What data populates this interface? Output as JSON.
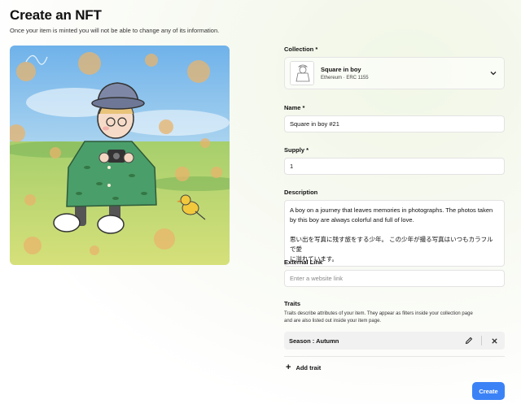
{
  "header": {
    "title": "Create an NFT",
    "subtitle": "Once your item is minted you will not be able to change any of its information."
  },
  "form": {
    "collection": {
      "label": "Collection *",
      "name": "Square in boy",
      "meta": "Ethereum  ·  ERC 1155"
    },
    "name": {
      "label": "Name *",
      "value": "Square in boy #21"
    },
    "supply": {
      "label": "Supply *",
      "value": "1"
    },
    "description": {
      "label": "Description",
      "line1": "A boy on a journey that leaves memories in photographs. The photos taken",
      "line2": "by this boy are always colorful and full of love.",
      "line3": "思い出を写真に残す旅をする少年。 この少年が撮る写真はいつもカラフルで愛",
      "line4": "に溢れています。"
    },
    "external_link": {
      "label": "External Link",
      "placeholder": "Enter a website link"
    },
    "traits": {
      "label": "Traits",
      "help1": "Traits describe attributes of your item. They appear as filters inside your collection page",
      "help2": "and are also listed out inside your item page.",
      "items": [
        {
          "text": "Season : Autumn"
        }
      ],
      "add_label": "Add trait"
    }
  },
  "actions": {
    "create_label": "Create"
  },
  "colors": {
    "accent": "#3b82f6",
    "trait_bg": "#f1f1f1"
  },
  "icons": [
    "chevron-down-icon",
    "pencil-icon",
    "close-icon",
    "plus-icon"
  ]
}
